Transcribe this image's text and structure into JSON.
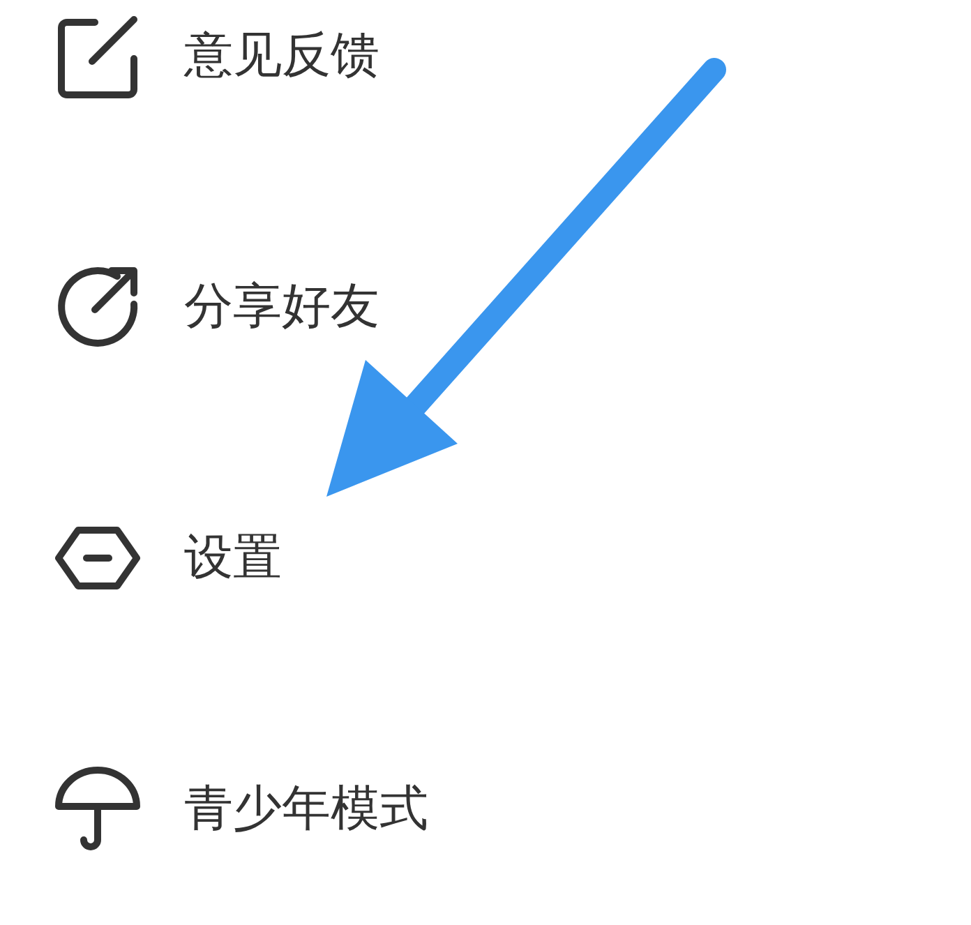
{
  "menu": {
    "items": [
      {
        "label": "意见反馈"
      },
      {
        "label": "分享好友"
      },
      {
        "label": "设置"
      },
      {
        "label": "青少年模式"
      }
    ]
  },
  "annotation": {
    "kind": "arrow"
  }
}
